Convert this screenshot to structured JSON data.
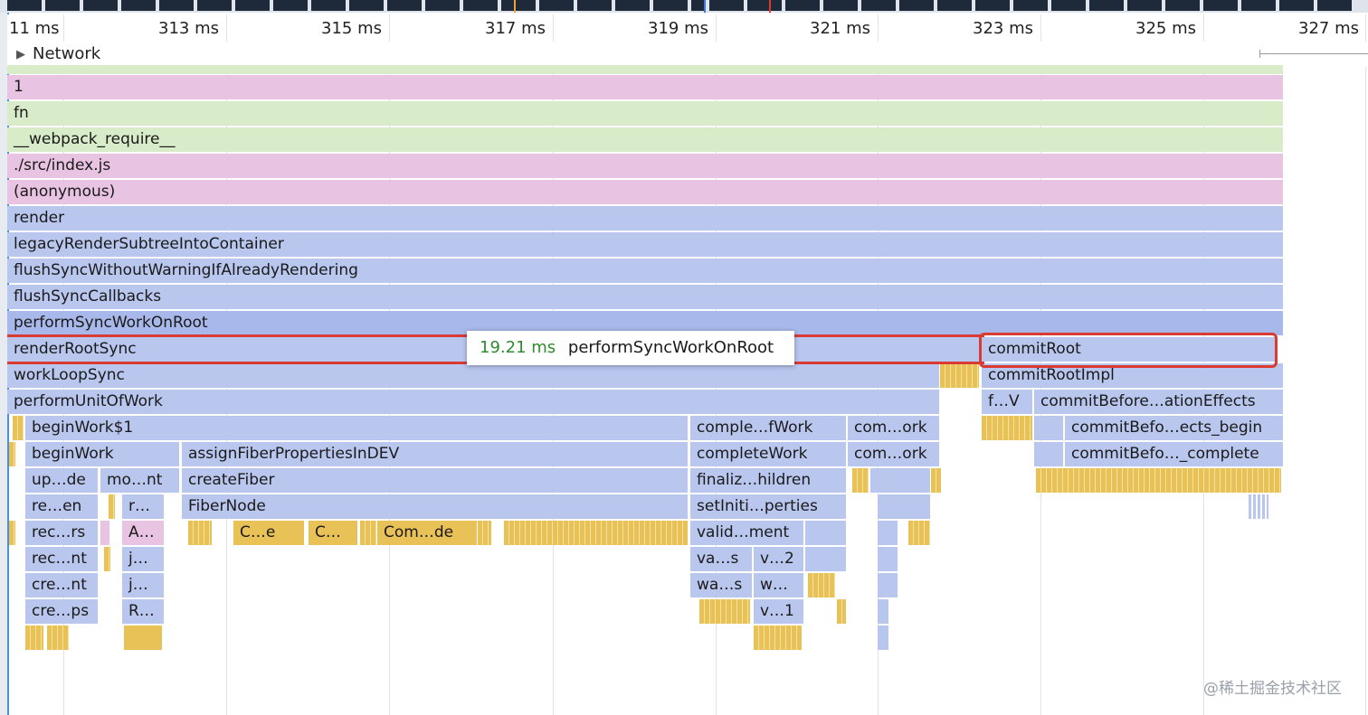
{
  "timeline": {
    "ticks": [
      "11 ms",
      "313 ms",
      "315 ms",
      "317 ms",
      "319 ms",
      "321 ms",
      "323 ms",
      "325 ms",
      "327 ms"
    ]
  },
  "network_track": {
    "label": "Network"
  },
  "flame": {
    "rows": [
      {
        "label": "1",
        "color": "pink"
      },
      {
        "label": "fn",
        "color": "green"
      },
      {
        "label": "__webpack_require__",
        "color": "green"
      },
      {
        "label": "./src/index.js",
        "color": "pink"
      },
      {
        "label": "(anonymous)",
        "color": "pink"
      },
      {
        "label": "render",
        "color": "blue"
      },
      {
        "label": "legacyRenderSubtreeIntoContainer",
        "color": "blue"
      },
      {
        "label": "flushSyncWithoutWarningIfAlreadyRendering",
        "color": "blue"
      },
      {
        "label": "flushSyncCallbacks",
        "color": "blue"
      },
      {
        "label": "performSyncWorkOnRoot",
        "color": "blue"
      }
    ],
    "render_root_sync": "renderRootSync",
    "work_loop_sync": "workLoopSync",
    "perform_unit_of_work": "performUnitOfWork",
    "commit_root": "commitRoot",
    "commit_root_impl": "commitRootImpl",
    "fv": "f…V",
    "commit_before_effects": "commitBefore…ationEffects",
    "begin_work_1": "beginWork$1",
    "comple_work": "comple…fWork",
    "com_ork_1": "com…ork",
    "commit_befo_begin": "commitBefo…ects_begin",
    "begin_work": "beginWork",
    "assign_fiber": "assignFiberPropertiesInDEV",
    "complete_work": "completeWork",
    "com_ork_2": "com…ork",
    "commit_befo_complete": "commitBefo…_complete",
    "up_de": "up…de",
    "mo_nt": "mo…nt",
    "create_fiber": "createFiber",
    "finaliz_hildren": "finaliz…hildren",
    "re_en": "re…en",
    "r_dots": "r…",
    "fiber_node": "FiberNode",
    "set_initi_perties": "setIniti…perties",
    "rec_rs": "rec…rs",
    "a_dots": "A…",
    "c_e": "C…e",
    "c_dots": "C…",
    "com_de": "Com…de",
    "valid_ment": "valid…ment",
    "rec_nt": "rec…nt",
    "j_dots_1": "j…",
    "va_s": "va…s",
    "v_2": "v…2",
    "cre_nt": "cre…nt",
    "j_dots_2": "j…",
    "wa_s": "wa…s",
    "w_dots": "w…",
    "cre_ps": "cre…ps",
    "r_dots_2": "R…",
    "v_1": "v…1"
  },
  "tooltip": {
    "time": "19.21 ms",
    "name": "performSyncWorkOnRoot"
  },
  "watermark": "@稀土掘金技术社区",
  "colors": {
    "green": "#d9ecca",
    "pink": "#e8c4e2",
    "blue": "#b9c6ee",
    "yellow": "#e8c157",
    "highlight": "#d93b33",
    "tooltip_time": "#2e8b2e"
  }
}
